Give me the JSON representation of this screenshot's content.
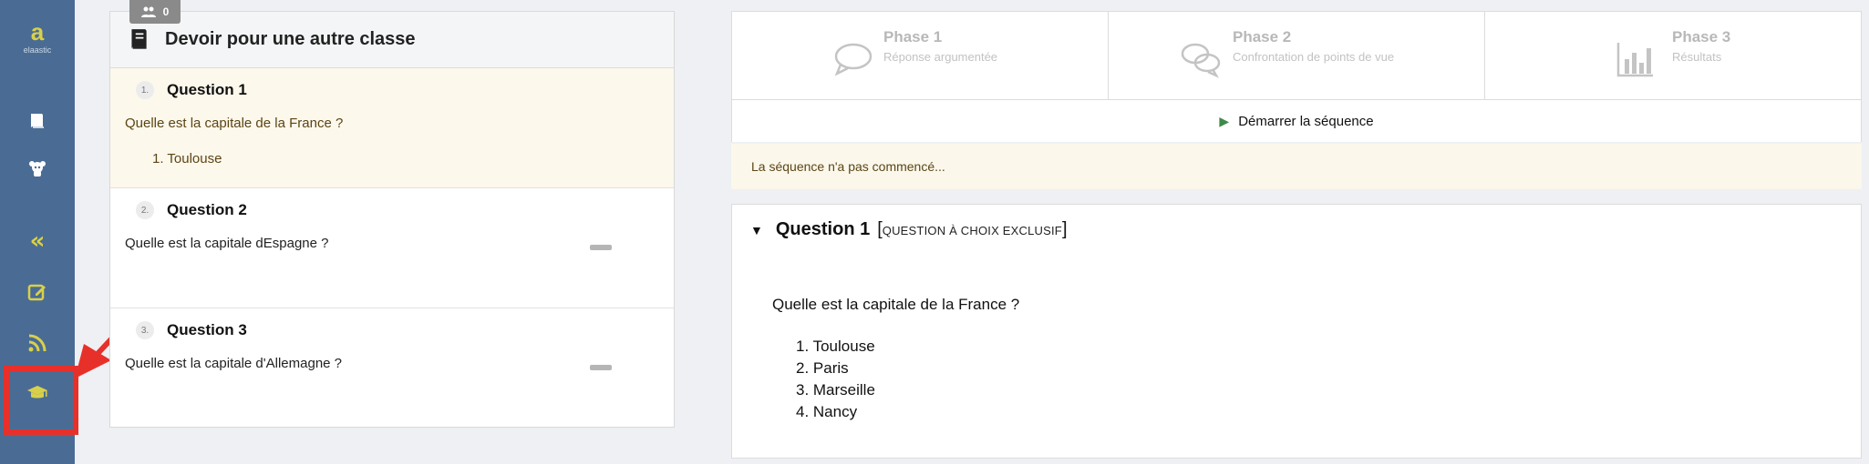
{
  "sidebar": {
    "brand_mark": "a",
    "brand_text": "elaastic",
    "icons": [
      "book-icon",
      "team-icon",
      "collapse-icon",
      "edit-icon",
      "rss-icon",
      "graduation-cap-icon"
    ],
    "accent": "#d8d04a",
    "background": "#4a6c94"
  },
  "left_panel": {
    "badge_count": "0",
    "title": "Devoir pour une autre classe",
    "questions": [
      {
        "number": "1.",
        "title": "Question 1",
        "text": "Quelle est la capitale de la France ?",
        "answer": "1. Toulouse"
      },
      {
        "number": "2.",
        "title": "Question 2",
        "text": "Quelle est la capitale dEspagne ?"
      },
      {
        "number": "3.",
        "title": "Question 3",
        "text": "Quelle est la capitale d'Allemagne ?"
      }
    ]
  },
  "phases": [
    {
      "name": "Phase 1",
      "subtitle": "Réponse argumentée",
      "icon": "speech-bubble-icon"
    },
    {
      "name": "Phase 2",
      "subtitle": "Confrontation de points de vue",
      "icon": "conversation-icon"
    },
    {
      "name": "Phase 3",
      "subtitle": "Résultats",
      "icon": "bar-chart-icon"
    }
  ],
  "start_button": {
    "label": "Démarrer la séquence"
  },
  "status": "La séquence n'a pas commencé...",
  "question_card": {
    "title": "Question 1",
    "type": "QUESTION À CHOIX EXCLUSIF",
    "text": "Quelle est la capitale de la France ?",
    "options": [
      "1. Toulouse",
      "2. Paris",
      "3. Marseille",
      "4. Nancy"
    ]
  },
  "annotation": {
    "color": "#e8302a"
  }
}
